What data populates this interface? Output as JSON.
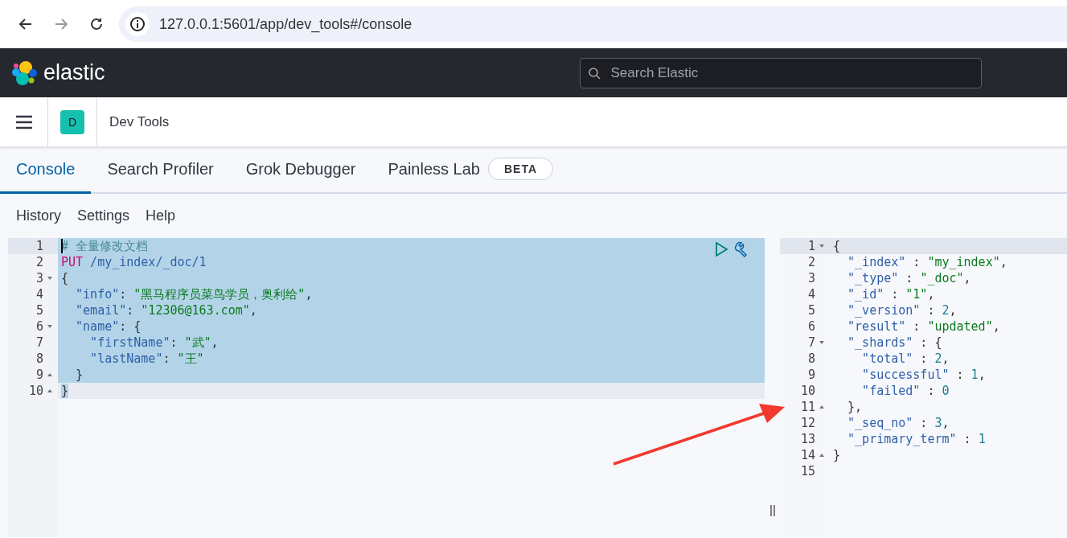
{
  "browser": {
    "url": "127.0.0.1:5601/app/dev_tools#/console"
  },
  "header": {
    "logo_text": "elastic",
    "search": {
      "placeholder": "Search Elastic"
    }
  },
  "breadcrumb": {
    "avatar": "D",
    "title": "Dev Tools"
  },
  "tabs": [
    {
      "label": "Console",
      "selected": true
    },
    {
      "label": "Search Profiler",
      "selected": false
    },
    {
      "label": "Grok Debugger",
      "selected": false
    },
    {
      "label": "Painless Lab",
      "selected": false,
      "badge": "BETA"
    }
  ],
  "menu": [
    "History",
    "Settings",
    "Help"
  ],
  "request_editor": {
    "lines": [
      {
        "num": "1",
        "fold_start": false,
        "fold_end": false,
        "selected": true,
        "selection_end": false,
        "cursor": true,
        "tokens": [
          {
            "t": "# 全量修改文档",
            "kind": "comment"
          }
        ]
      },
      {
        "num": "2",
        "fold_start": false,
        "fold_end": false,
        "selected": true,
        "selection_end": false,
        "cursor": false,
        "tokens": [
          {
            "t": "PUT",
            "kind": "method"
          },
          {
            "t": " /my_index/_doc/1",
            "kind": "path"
          }
        ]
      },
      {
        "num": "3",
        "fold_start": true,
        "fold_end": false,
        "selected": true,
        "selection_end": false,
        "cursor": false,
        "tokens": [
          {
            "t": "{",
            "kind": "punct"
          }
        ]
      },
      {
        "num": "4",
        "fold_start": false,
        "fold_end": false,
        "selected": true,
        "selection_end": false,
        "cursor": false,
        "tokens": [
          {
            "t": "  \"info\"",
            "kind": "key"
          },
          {
            "t": ": ",
            "kind": "punct"
          },
          {
            "t": "\"黑马程序员菜鸟学员，奥利给\"",
            "kind": "string"
          },
          {
            "t": ",",
            "kind": "punct"
          }
        ]
      },
      {
        "num": "5",
        "fold_start": false,
        "fold_end": false,
        "selected": true,
        "selection_end": false,
        "cursor": false,
        "tokens": [
          {
            "t": "  \"email\"",
            "kind": "key"
          },
          {
            "t": ": ",
            "kind": "punct"
          },
          {
            "t": "\"12306@163.com\"",
            "kind": "string"
          },
          {
            "t": ",",
            "kind": "punct"
          }
        ]
      },
      {
        "num": "6",
        "fold_start": true,
        "fold_end": false,
        "selected": true,
        "selection_end": false,
        "cursor": false,
        "tokens": [
          {
            "t": "  \"name\"",
            "kind": "key"
          },
          {
            "t": ": {",
            "kind": "punct"
          }
        ]
      },
      {
        "num": "7",
        "fold_start": false,
        "fold_end": false,
        "selected": true,
        "selection_end": false,
        "cursor": false,
        "tokens": [
          {
            "t": "    \"firstName\"",
            "kind": "key"
          },
          {
            "t": ": ",
            "kind": "punct"
          },
          {
            "t": "\"武\"",
            "kind": "string"
          },
          {
            "t": ",",
            "kind": "punct"
          }
        ]
      },
      {
        "num": "8",
        "fold_start": false,
        "fold_end": false,
        "selected": true,
        "selection_end": false,
        "cursor": false,
        "tokens": [
          {
            "t": "    \"lastName\"",
            "kind": "key"
          },
          {
            "t": ": ",
            "kind": "punct"
          },
          {
            "t": "\"王\"",
            "kind": "string"
          }
        ]
      },
      {
        "num": "9",
        "fold_start": false,
        "fold_end": true,
        "selected": true,
        "selection_end": false,
        "cursor": false,
        "tokens": [
          {
            "t": "  }",
            "kind": "punct"
          }
        ]
      },
      {
        "num": "10",
        "fold_start": false,
        "fold_end": true,
        "selected": false,
        "selection_end": true,
        "cursor": false,
        "tokens": [
          {
            "t": "}",
            "kind": "punct"
          }
        ]
      }
    ]
  },
  "response_viewer": {
    "lines": [
      {
        "num": "1",
        "fold_start": true,
        "fold_end": false,
        "active": true,
        "tokens": [
          {
            "t": "{",
            "kind": "punct"
          }
        ]
      },
      {
        "num": "2",
        "fold_start": false,
        "fold_end": false,
        "active": false,
        "tokens": [
          {
            "t": "  \"_index\"",
            "kind": "key"
          },
          {
            "t": " : ",
            "kind": "punct"
          },
          {
            "t": "\"my_index\"",
            "kind": "string"
          },
          {
            "t": ",",
            "kind": "punct"
          }
        ]
      },
      {
        "num": "3",
        "fold_start": false,
        "fold_end": false,
        "active": false,
        "tokens": [
          {
            "t": "  \"_type\"",
            "kind": "key"
          },
          {
            "t": " : ",
            "kind": "punct"
          },
          {
            "t": "\"_doc\"",
            "kind": "string"
          },
          {
            "t": ",",
            "kind": "punct"
          }
        ]
      },
      {
        "num": "4",
        "fold_start": false,
        "fold_end": false,
        "active": false,
        "tokens": [
          {
            "t": "  \"_id\"",
            "kind": "key"
          },
          {
            "t": " : ",
            "kind": "punct"
          },
          {
            "t": "\"1\"",
            "kind": "string"
          },
          {
            "t": ",",
            "kind": "punct"
          }
        ]
      },
      {
        "num": "5",
        "fold_start": false,
        "fold_end": false,
        "active": false,
        "tokens": [
          {
            "t": "  \"_version\"",
            "kind": "key"
          },
          {
            "t": " : ",
            "kind": "punct"
          },
          {
            "t": "2",
            "kind": "number"
          },
          {
            "t": ",",
            "kind": "punct"
          }
        ]
      },
      {
        "num": "6",
        "fold_start": false,
        "fold_end": false,
        "active": false,
        "tokens": [
          {
            "t": "  \"result\"",
            "kind": "key"
          },
          {
            "t": " : ",
            "kind": "punct"
          },
          {
            "t": "\"updated\"",
            "kind": "string"
          },
          {
            "t": ",",
            "kind": "punct"
          }
        ]
      },
      {
        "num": "7",
        "fold_start": true,
        "fold_end": false,
        "active": false,
        "tokens": [
          {
            "t": "  \"_shards\"",
            "kind": "key"
          },
          {
            "t": " : {",
            "kind": "punct"
          }
        ]
      },
      {
        "num": "8",
        "fold_start": false,
        "fold_end": false,
        "active": false,
        "tokens": [
          {
            "t": "    \"total\"",
            "kind": "key"
          },
          {
            "t": " : ",
            "kind": "punct"
          },
          {
            "t": "2",
            "kind": "number"
          },
          {
            "t": ",",
            "kind": "punct"
          }
        ]
      },
      {
        "num": "9",
        "fold_start": false,
        "fold_end": false,
        "active": false,
        "tokens": [
          {
            "t": "    \"successful\"",
            "kind": "key"
          },
          {
            "t": " : ",
            "kind": "punct"
          },
          {
            "t": "1",
            "kind": "number"
          },
          {
            "t": ",",
            "kind": "punct"
          }
        ]
      },
      {
        "num": "10",
        "fold_start": false,
        "fold_end": false,
        "active": false,
        "tokens": [
          {
            "t": "    \"failed\"",
            "kind": "key"
          },
          {
            "t": " : ",
            "kind": "punct"
          },
          {
            "t": "0",
            "kind": "number"
          }
        ]
      },
      {
        "num": "11",
        "fold_start": false,
        "fold_end": true,
        "active": false,
        "tokens": [
          {
            "t": "  },",
            "kind": "punct"
          }
        ]
      },
      {
        "num": "12",
        "fold_start": false,
        "fold_end": false,
        "active": false,
        "tokens": [
          {
            "t": "  \"_seq_no\"",
            "kind": "key"
          },
          {
            "t": " : ",
            "kind": "punct"
          },
          {
            "t": "3",
            "kind": "number"
          },
          {
            "t": ",",
            "kind": "punct"
          }
        ]
      },
      {
        "num": "13",
        "fold_start": false,
        "fold_end": false,
        "active": false,
        "tokens": [
          {
            "t": "  \"_primary_term\"",
            "kind": "key"
          },
          {
            "t": " : ",
            "kind": "punct"
          },
          {
            "t": "1",
            "kind": "number"
          }
        ]
      },
      {
        "num": "14",
        "fold_start": false,
        "fold_end": true,
        "active": false,
        "tokens": [
          {
            "t": "}",
            "kind": "punct"
          }
        ]
      },
      {
        "num": "15",
        "fold_start": false,
        "fold_end": false,
        "active": false
      }
    ]
  }
}
